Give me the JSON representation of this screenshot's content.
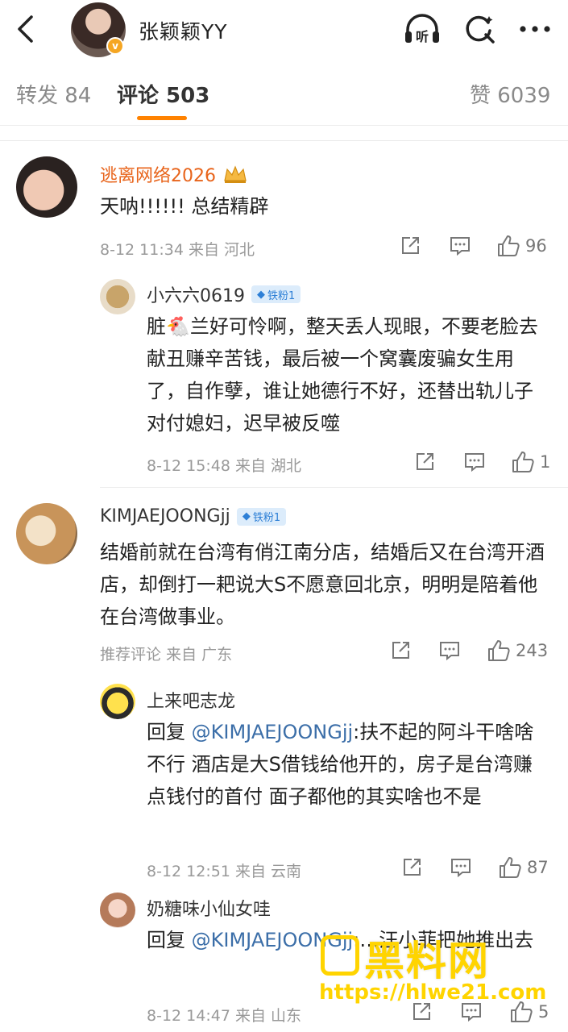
{
  "header": {
    "title": "张颖颖YY",
    "verified_badge": "v",
    "icons": [
      "back-icon",
      "listen-icon",
      "search-icon",
      "more-icon"
    ],
    "listen_label": "听"
  },
  "tabs": {
    "repost": "转发 84",
    "comment": "评论 503",
    "like": "赞 6039"
  },
  "comments": [
    {
      "name": "逃离网络2026",
      "text": "天呐!!!!!!  总结精辟",
      "meta": "8-12 11:34  来自 河北",
      "likes": "96"
    },
    {
      "name": "小六六0619",
      "badge": "铁粉1",
      "text": "脏🐔兰好可怜啊，整天丢人现眼，不要老脸去献丑赚辛苦钱，最后被一个窝囊废骗女生用了，自作孽，谁让她德行不好，还替出轨儿子对付媳妇，迟早被反噬",
      "meta": "8-12 15:48  来自 湖北",
      "likes": "1"
    },
    {
      "name": "KIMJAEJOONGjj",
      "badge": "铁粉1",
      "text": "结婚前就在台湾有俏江南分店，结婚后又在台湾开酒店，却倒打一耙说大S不愿意回北京，明明是陪着他在台湾做事业。",
      "meta": "推荐评论  来自 广东",
      "likes": "243"
    },
    {
      "name": "上来吧志龙",
      "reply_prefix": "回复",
      "mention": "@KIMJAEJOONGjj",
      "text": ":扶不起的阿斗干啥啥不行 酒店是大S借钱给他开的，房子是台湾赚点钱付的首付 面子都他的其实啥也不是",
      "meta": "8-12 12:51  来自 云南",
      "likes": "87"
    },
    {
      "name": "奶糖味小仙女哇",
      "reply_prefix": "回复",
      "mention": "@KIMJAEJOONGjj",
      "text": ":…汪小菲把她推出去",
      "meta": "8-12 14:47  来自 山东",
      "likes": "5"
    }
  ],
  "watermark": {
    "brand": "黑料网",
    "url": "https://hlwe21.com"
  }
}
